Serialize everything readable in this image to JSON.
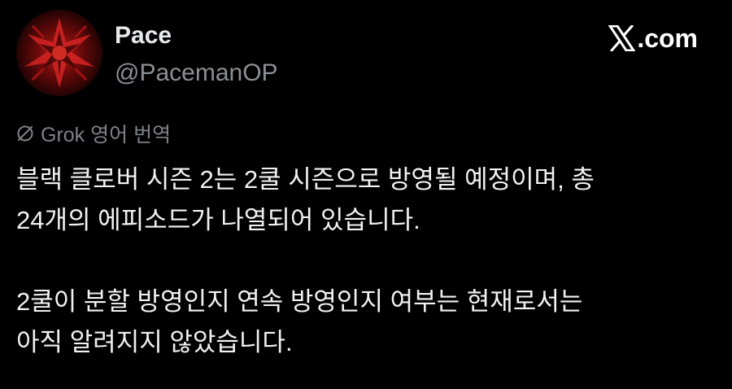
{
  "author": {
    "display_name": "Pace",
    "handle": "@PacemanOP",
    "avatar_icon": "red-dark-emblem-avatar"
  },
  "source": {
    "logo_icon": "x-logo-icon",
    "domain": ".com"
  },
  "translation": {
    "icon": "grok-icon",
    "label": "Grok 영어 번역"
  },
  "body": {
    "paragraphs": [
      {
        "lines": [
          "블랙 클로버 시즌 2는 2쿨 시즌으로 방영될 예정이며, 총",
          "24개의 에피소드가 나열되어 있습니다."
        ]
      },
      {
        "lines": [
          "2쿨이 분할 방영인지 연속 방영인지 여부는 현재로서는",
          "아직 알려지지 않았습니다."
        ]
      }
    ]
  },
  "colors": {
    "background": "#000000",
    "primary_text": "#e7e9ea",
    "secondary_text": "#8b9095",
    "avatar_accent": "#b01515"
  }
}
